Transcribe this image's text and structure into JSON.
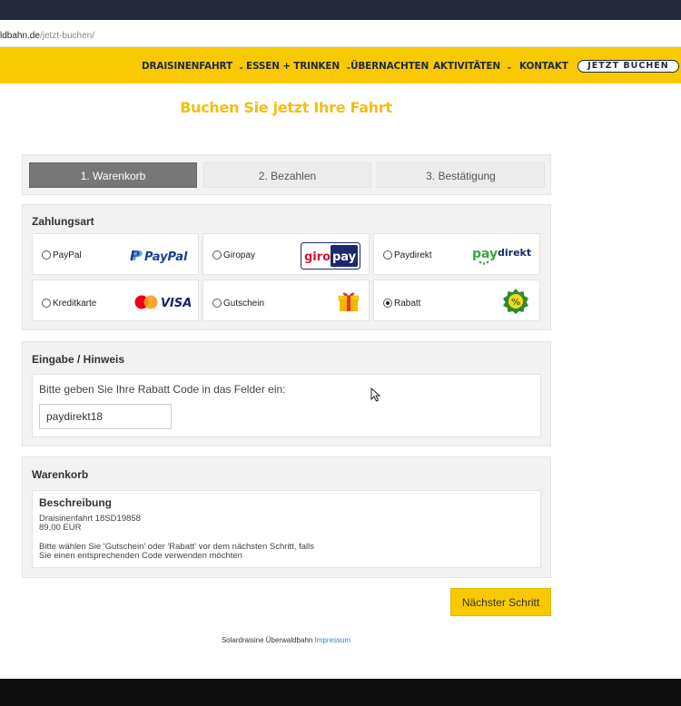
{
  "browser": {
    "url_host": "ldbahn.de",
    "url_path": "/jetzt-buchen/"
  },
  "nav": {
    "items": [
      {
        "label": "DRAISINENFAHRT",
        "dropdown": true
      },
      {
        "label": "ESSEN + TRINKEN",
        "dropdown": true
      },
      {
        "label": "ÜBERNACHTEN",
        "dropdown": false
      },
      {
        "label": "AKTIVITÄTEN",
        "dropdown": true
      },
      {
        "label": "KONTAKT",
        "dropdown": false
      }
    ],
    "cta": "JETZT BUCHEN",
    "chevron": "⌄"
  },
  "page_title": "Buchen Sie jetzt Ihre Fahrt",
  "steps": [
    {
      "label": "1.  Warenkorb",
      "active": true
    },
    {
      "label": "2.  Bezahlen",
      "active": false
    },
    {
      "label": "3.  Bestätigung",
      "active": false
    }
  ],
  "payment": {
    "title": "Zahlungsart",
    "options": [
      {
        "label": "PayPal",
        "logo_text": "PayPal",
        "icon": "paypal-icon",
        "selected": false
      },
      {
        "label": "Giropay",
        "logo_text_a": "giro",
        "logo_text_b": "pay",
        "icon": "giropay-icon",
        "selected": false
      },
      {
        "label": "Paydirekt",
        "logo_text_a": "pay",
        "logo_text_b": "direkt",
        "icon": "paydirekt-icon",
        "selected": false
      },
      {
        "label": "Kreditkarte",
        "logo_text": "VISA",
        "icon": "mastercard-visa-icon",
        "selected": false
      },
      {
        "label": "Gutschein",
        "icon": "gift-icon",
        "selected": false
      },
      {
        "label": "Rabatt",
        "logo_text": "%",
        "icon": "discount-badge-icon",
        "selected": true
      }
    ]
  },
  "eingabe": {
    "title": "Eingabe / Hinweis",
    "hint": "Bitte geben Sie Ihre Rabatt Code in das Felder ein:",
    "code_value": "paydirekt18"
  },
  "cart": {
    "title": "Warenkorb",
    "desc_title": "Beschreibung",
    "item_name": "Draisinenfahrt 18SD19858",
    "item_price": "89,00 EUR",
    "note_line1": "Bitte wählen Sie 'Gutschein' oder 'Rabatt' vor dem nächsten Schritt, falls",
    "note_line2": "Sie einen entsprechenden Code verwenden möchten"
  },
  "next_button": "Nächster Schritt",
  "footer": {
    "text": "Solardraisine Überwaldbahn",
    "link": "Impressum"
  },
  "colors": {
    "brand_yellow": "#f9c900",
    "title_yellow": "#f5bd13",
    "nav_text": "#1f2a44"
  }
}
